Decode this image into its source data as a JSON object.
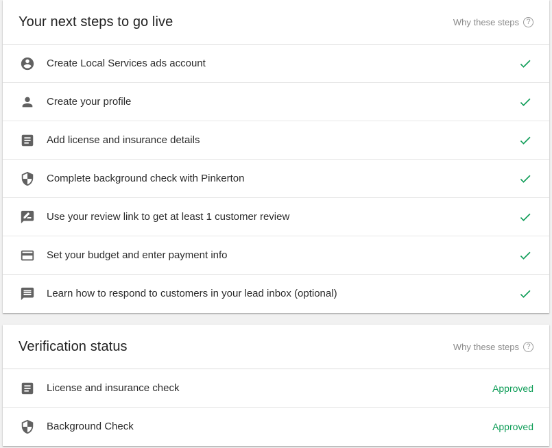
{
  "steps_card": {
    "title": "Your next steps to go live",
    "help_label": "Why these steps",
    "help_icon": "help-circle-icon",
    "items": [
      {
        "label": "Create Local Services ads account",
        "icon": "account-circle-icon",
        "done": true
      },
      {
        "label": "Create your profile",
        "icon": "person-icon",
        "done": true
      },
      {
        "label": "Add license and insurance details",
        "icon": "document-icon",
        "done": true
      },
      {
        "label": "Complete background check with Pinkerton",
        "icon": "shield-icon",
        "done": true
      },
      {
        "label": "Use your review link to get at least 1 customer review",
        "icon": "rate-review-icon",
        "done": true
      },
      {
        "label": "Set your budget and enter payment info",
        "icon": "credit-card-icon",
        "done": true
      },
      {
        "label": "Learn how to respond to customers in your lead inbox (optional)",
        "icon": "message-icon",
        "done": true
      }
    ]
  },
  "verification_card": {
    "title": "Verification status",
    "help_label": "Why these steps",
    "items": [
      {
        "label": "License and insurance check",
        "icon": "document-icon",
        "status": "Approved"
      },
      {
        "label": "Background Check",
        "icon": "shield-icon",
        "status": "Approved"
      }
    ]
  },
  "colors": {
    "check": "#0f9d58",
    "approved": "#0f9d58",
    "icon": "#616161"
  }
}
